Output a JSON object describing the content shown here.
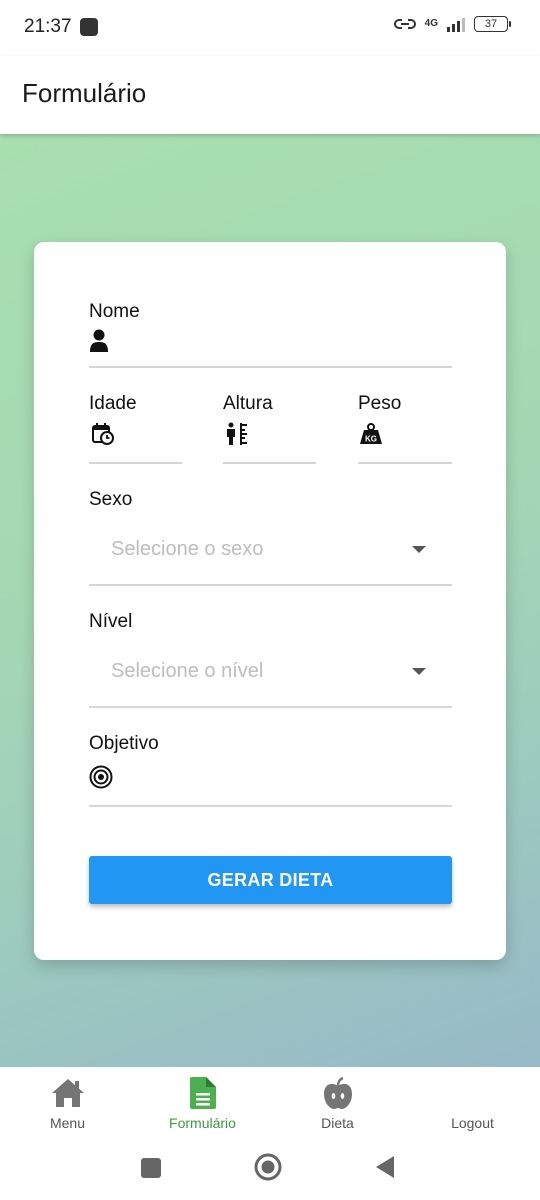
{
  "status_bar": {
    "time": "21:37",
    "network": "4G",
    "battery": "37"
  },
  "app_bar": {
    "title": "Formulário"
  },
  "form": {
    "name_label": "Nome",
    "age_label": "Idade",
    "height_label": "Altura",
    "weight_label": "Peso",
    "sex_label": "Sexo",
    "sex_placeholder": "Selecione o sexo",
    "level_label": "Nível",
    "level_placeholder": "Selecione o nível",
    "goal_label": "Objetivo",
    "submit_label": "GERAR DIETA"
  },
  "bottom_nav": {
    "items": [
      {
        "label": "Menu",
        "icon": "home-icon",
        "active": false
      },
      {
        "label": "Formulário",
        "icon": "document-icon",
        "active": true
      },
      {
        "label": "Dieta",
        "icon": "apple-icon",
        "active": false
      },
      {
        "label": "Logout",
        "icon": "",
        "active": false
      }
    ]
  },
  "colors": {
    "accent": "#2196f3",
    "active_nav": "#3a9b3f",
    "gradient_top": "#a8dfaf",
    "gradient_bottom": "#97b9c8"
  }
}
